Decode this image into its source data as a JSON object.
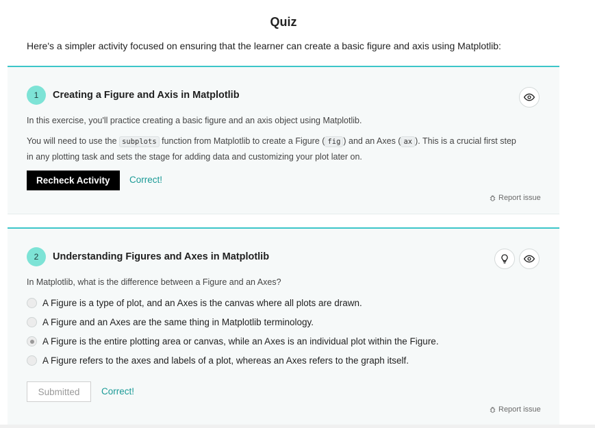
{
  "quiz": {
    "title": "Quiz",
    "intro": "Here's a simpler activity focused on ensuring that the learner can create a basic figure and axis using Matplotlib:"
  },
  "question1": {
    "number": "1",
    "title": "Creating a Figure and Axis in Matplotlib",
    "description": "In this exercise, you'll practice creating a basic figure and an axis object using Matplotlib.",
    "instruction_part1": "You will need to use the ",
    "code_subplots": "subplots",
    "instruction_part2": " function from Matplotlib to create a Figure (",
    "code_fig": "fig",
    "instruction_part3": ") and an Axes (",
    "code_ax": "ax",
    "instruction_part4": "). This is a crucial first step",
    "instruction_line2": "in any plotting task and sets the stage for adding data and customizing your plot later on.",
    "recheck_label": "Recheck Activity",
    "status": "Correct!",
    "report_label": "Report issue"
  },
  "question2": {
    "number": "2",
    "title": "Understanding Figures and Axes in Matplotlib",
    "prompt": "In Matplotlib, what is the difference between a Figure and an Axes?",
    "options": [
      "A Figure is a type of plot, and an Axes is the canvas where all plots are drawn.",
      "A Figure and an Axes are the same thing in Matplotlib terminology.",
      "A Figure is the entire plotting area or canvas, while an Axes is an individual plot within the Figure.",
      "A Figure refers to the axes and labels of a plot, whereas an Axes refers to the graph itself."
    ],
    "selected_index": 2,
    "submitted_label": "Submitted",
    "status": "Correct!",
    "report_label": "Report issue"
  },
  "colors": {
    "accent": "#3cc6c9",
    "number_badge": "#7de3d6",
    "correct_text": "#1a9a96",
    "card_bg": "#f6f9f9"
  },
  "icons": {
    "reveal": "eye-icon",
    "hint": "lightbulb-icon",
    "report": "bug-icon"
  }
}
